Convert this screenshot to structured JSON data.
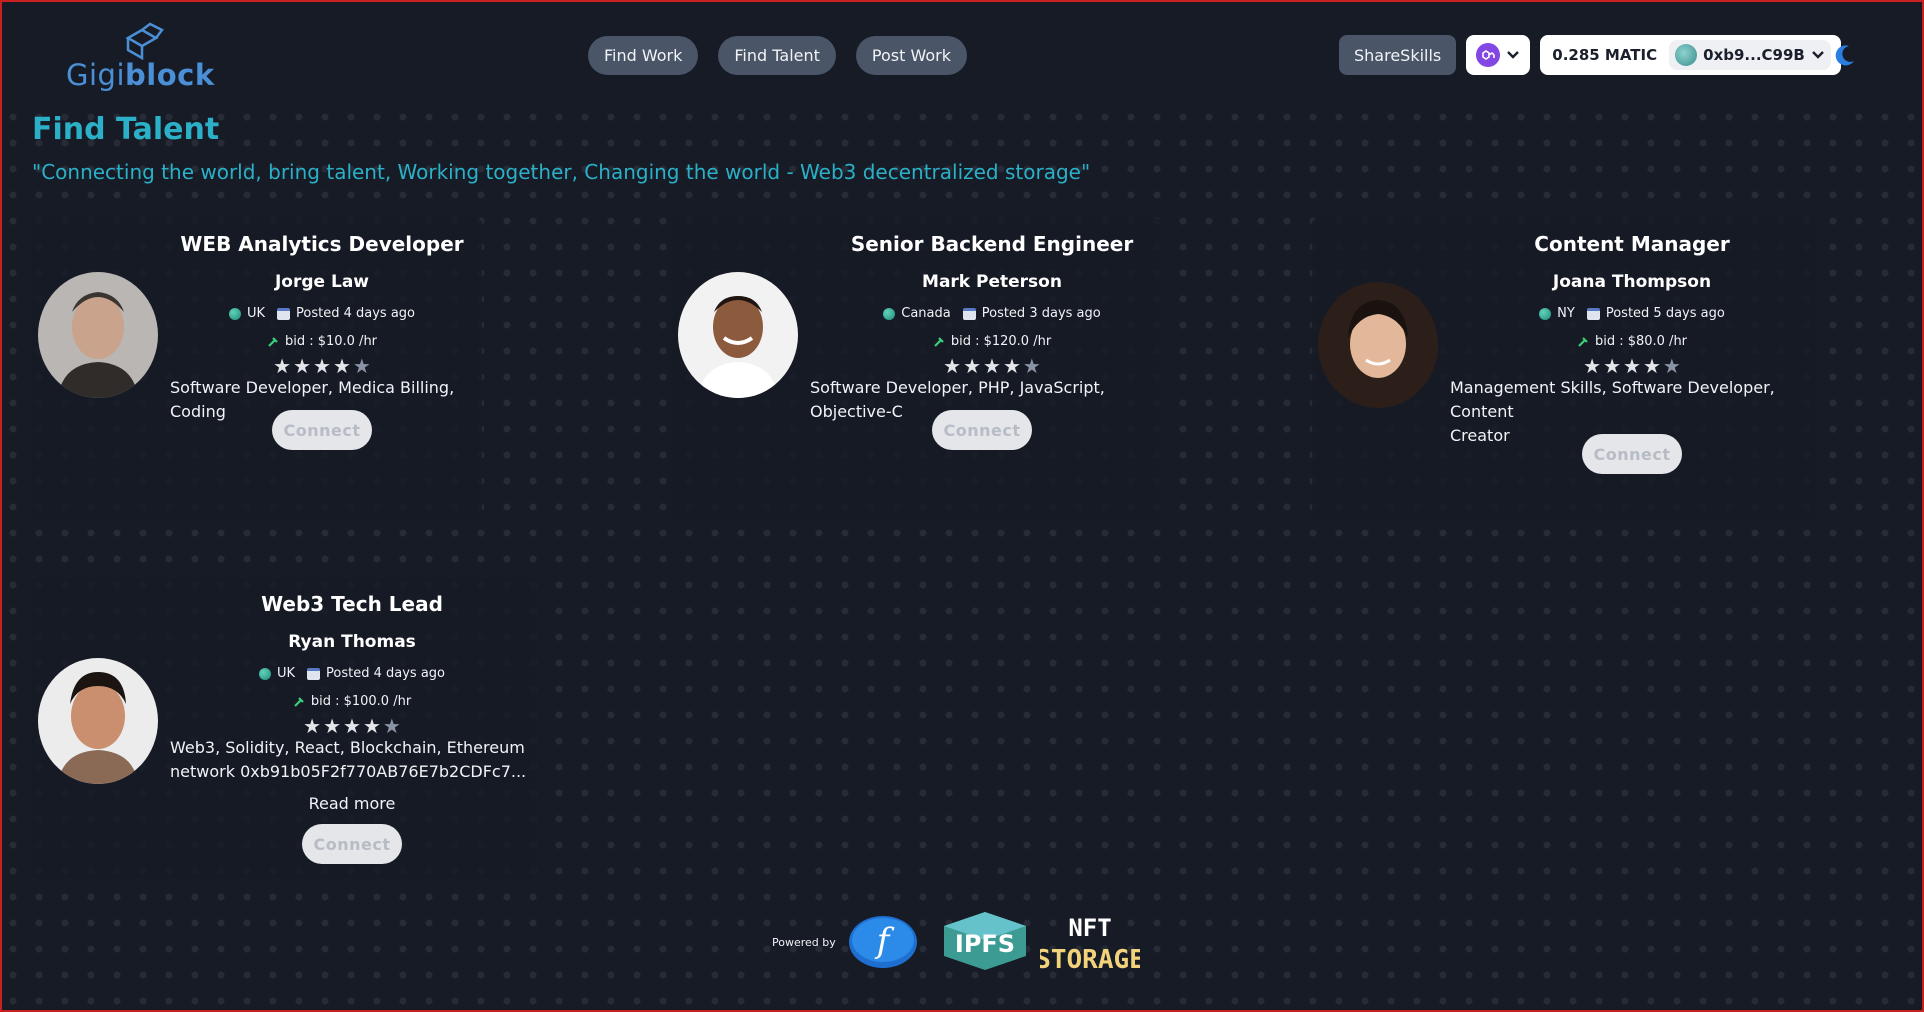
{
  "brand": {
    "logo_part1": "Gigi",
    "logo_part2": "block",
    "logo_icon": "cube-logo-icon"
  },
  "nav": {
    "find_work": "Find Work",
    "find_talent": "Find Talent",
    "post_work": "Post Work"
  },
  "toolbar": {
    "shareskills": "ShareSkills",
    "network_icon": "polygon-network-icon",
    "balance": "0.285 MATIC",
    "address": "0xb9...C99B",
    "theme_icon": "moon-icon"
  },
  "page": {
    "title": "Find Talent",
    "tagline": "\"Connecting the world, bring talent, Working together, Changing the world - Web3 decentralized storage\""
  },
  "cards": [
    {
      "title": "WEB Analytics Developer",
      "name": "Jorge Law",
      "location": "UK",
      "posted": "Posted 4 days ago",
      "bid": "bid : $10.0 /hr",
      "rating": 4,
      "skills": "Software Developer, Medica Billing, Coding",
      "connect": "Connect",
      "photo_colors": [
        "#b7b4b0",
        "#3a3531"
      ]
    },
    {
      "title": "Senior Backend Engineer",
      "name": "Mark Peterson",
      "location": "Canada",
      "posted": "Posted 3 days ago",
      "bid": "bid : $120.0 /hr",
      "rating": 4,
      "skills": "Software Developer, PHP, JavaScript, Objective-C",
      "connect": "Connect",
      "photo_colors": [
        "#f2f2f2",
        "#8c5a3c"
      ]
    },
    {
      "title": "Content Manager",
      "name": "Joana Thompson",
      "location": "NY",
      "posted": "Posted 5 days ago",
      "bid": "bid : $80.0 /hr",
      "rating": 4,
      "skills_line1": "Management Skills, Software Developer, Content",
      "skills_line2": "Creator",
      "connect": "Connect",
      "photo_colors": [
        "#3a2a22",
        "#e3b89a"
      ]
    },
    {
      "title": "Web3 Tech Lead",
      "name": "Ryan Thomas",
      "location": "UK",
      "posted": "Posted 4 days ago",
      "bid": "bid : $100.0 /hr",
      "rating": 4,
      "skills_line1": "Web3, Solidity, React, Blockchain, Ethereum",
      "skills_line2": "network 0xb91b05F2f770AB76E7b2CDFc7...",
      "read_more": "Read more",
      "connect": "Connect",
      "photo_colors": [
        "#ececec",
        "#c98f6e"
      ]
    }
  ],
  "footer": {
    "powered_by": "Powered by",
    "fil_logo": "filecoin-logo-icon",
    "ipfs": "IPFS",
    "nft_line1": "NFT",
    "nft_line2": "STORAGE"
  }
}
